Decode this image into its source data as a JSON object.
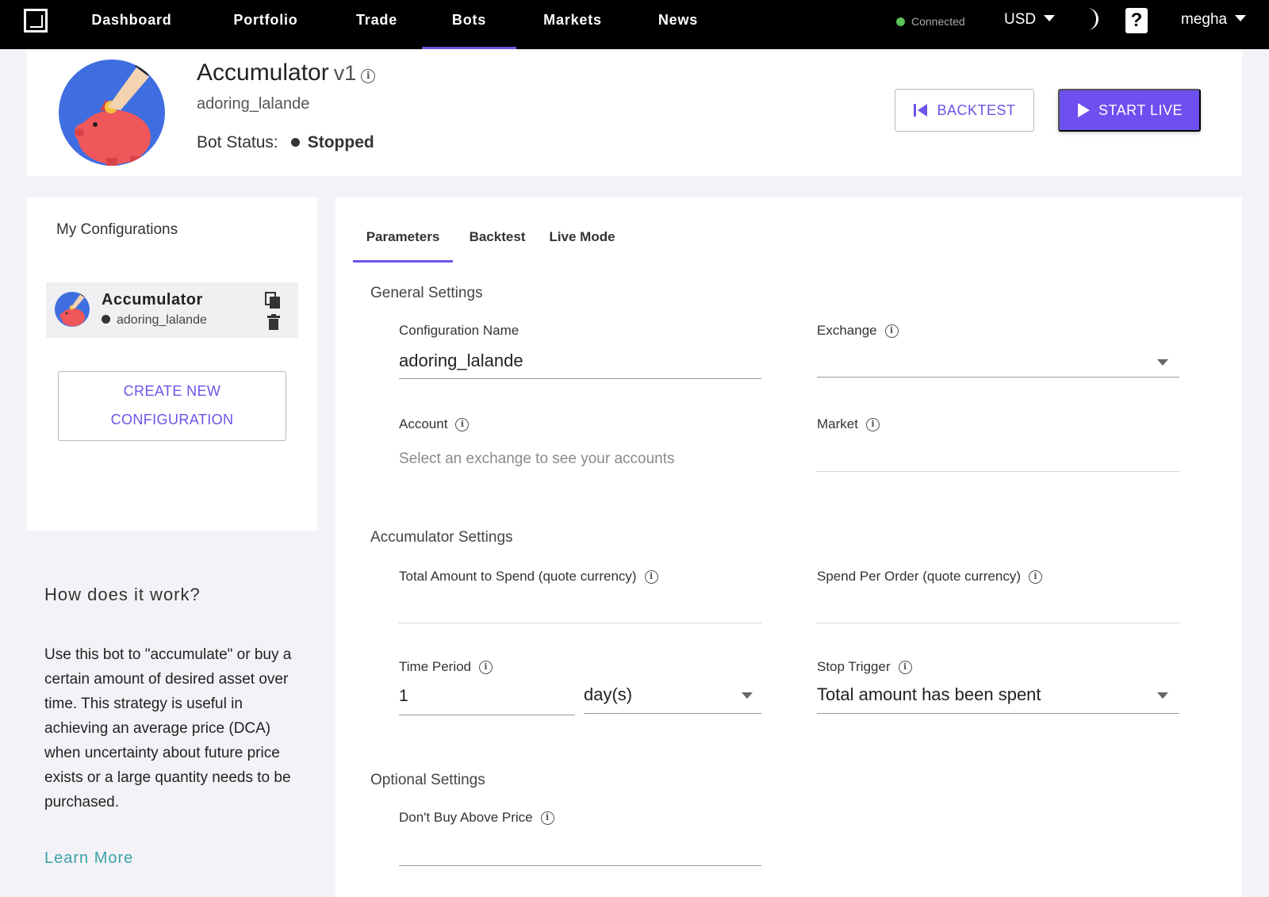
{
  "nav": {
    "items": [
      {
        "label": "Dashboard"
      },
      {
        "label": "Portfolio"
      },
      {
        "label": "Trade"
      },
      {
        "label": "Bots"
      },
      {
        "label": "Markets"
      },
      {
        "label": "News"
      }
    ],
    "active": "Bots",
    "connection_status": "Connected",
    "currency": "USD",
    "username": "megha",
    "help_glyph": "?"
  },
  "bot": {
    "name": "Accumulator",
    "version": "v1",
    "config_name": "adoring_lalande",
    "status_label": "Bot Status:",
    "status_value": "Stopped",
    "backtest_label": "BACKTEST",
    "start_live_label": "START LIVE"
  },
  "sidebar": {
    "title": "My Configurations",
    "config_item": {
      "name": "Accumulator",
      "sub": "adoring_lalande"
    },
    "create_line1": "CREATE NEW",
    "create_line2": "CONFIGURATION",
    "how_title": "How does it work?",
    "how_text": "Use this bot to \"accumulate\" or buy a certain amount of desired asset over time. This strategy is useful in achieving an average price (DCA) when uncertainty about future price exists or a large quantity needs to be purchased.",
    "learn_more": "Learn More"
  },
  "tabs": [
    {
      "label": "Parameters"
    },
    {
      "label": "Backtest"
    },
    {
      "label": "Live Mode"
    }
  ],
  "form": {
    "general": {
      "title": "General Settings",
      "config_name_label": "Configuration Name",
      "config_name_value": "adoring_lalande",
      "exchange_label": "Exchange",
      "account_label": "Account",
      "account_placeholder": "Select an exchange to see your accounts",
      "market_label": "Market"
    },
    "accumulator": {
      "title": "Accumulator Settings",
      "total_label": "Total Amount to Spend (quote currency)",
      "per_order_label": "Spend Per Order (quote currency)",
      "time_period_label": "Time Period",
      "time_period_value": "1",
      "time_unit_value": "day(s)",
      "stop_trigger_label": "Stop Trigger",
      "stop_trigger_value": "Total amount has been spent"
    },
    "optional": {
      "title": "Optional Settings",
      "dont_buy_label": "Don't Buy Above Price"
    }
  },
  "colors": {
    "accent": "#6c55e8",
    "start_button": "#6e4ff0",
    "connected": "#5ac05a",
    "learn_more": "#3aa1a6",
    "avatar_bg": "#3f6ee0"
  }
}
